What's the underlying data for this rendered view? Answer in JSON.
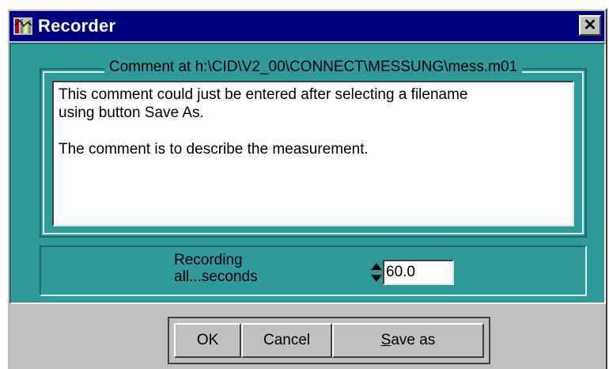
{
  "window": {
    "title": "Recorder",
    "close_glyph": "✕",
    "icon": "recorder-app-icon"
  },
  "comment_group": {
    "legend": "Comment at h:\\CID\\V2_00\\CONNECT\\MESSUNG\\mess.m01",
    "text": "This comment could just be entered after selecting a filename\nusing button Save As.\n\nThe comment is to describe the measurement."
  },
  "recording": {
    "label_line1": "Recording",
    "label_line2": "all...seconds",
    "value": "60.0"
  },
  "buttons": {
    "ok_label": "OK",
    "cancel_label": "Cancel",
    "saveas_accel": "S",
    "saveas_rest": "ave as"
  },
  "colors": {
    "titlebar": "#000080",
    "panel": "#2e9a9a",
    "face": "#c0c0c0"
  }
}
